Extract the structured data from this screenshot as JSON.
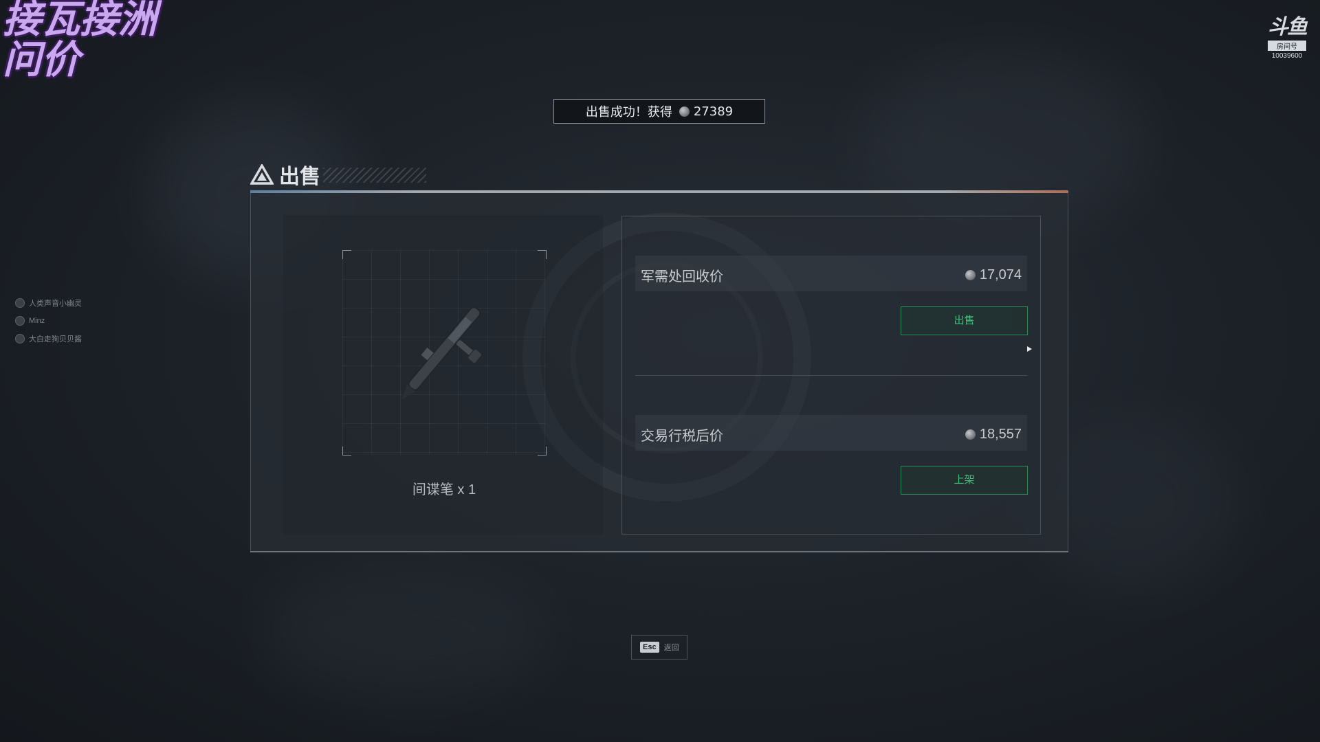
{
  "overlay": {
    "line1": "接瓦接洲",
    "line2": "问价"
  },
  "logo": {
    "mark": "斗鱼",
    "sub": "房间号",
    "room_id": "10039600"
  },
  "toast": {
    "text": "出售成功！获得",
    "amount": "27389"
  },
  "left_list": [
    {
      "label": "人类声音小幽灵"
    },
    {
      "label": "Minz"
    },
    {
      "label": "大白走狗贝贝酱"
    }
  ],
  "panel": {
    "title": "出售"
  },
  "item": {
    "name": "间谍笔 x 1"
  },
  "prices": {
    "recycle": {
      "label": "军需处回收价",
      "value": "17,074",
      "button": "出售"
    },
    "market": {
      "label": "交易行税后价",
      "value": "18,557",
      "button": "上架"
    }
  },
  "footer": {
    "key": "Esc",
    "label": "返回"
  },
  "colors": {
    "accent_green": "#3fc07a",
    "overlay_purple": "#c9a8f0"
  },
  "icons": [
    "warning-triangle-icon",
    "coin-icon",
    "spy-pen-icon",
    "cursor-icon"
  ]
}
